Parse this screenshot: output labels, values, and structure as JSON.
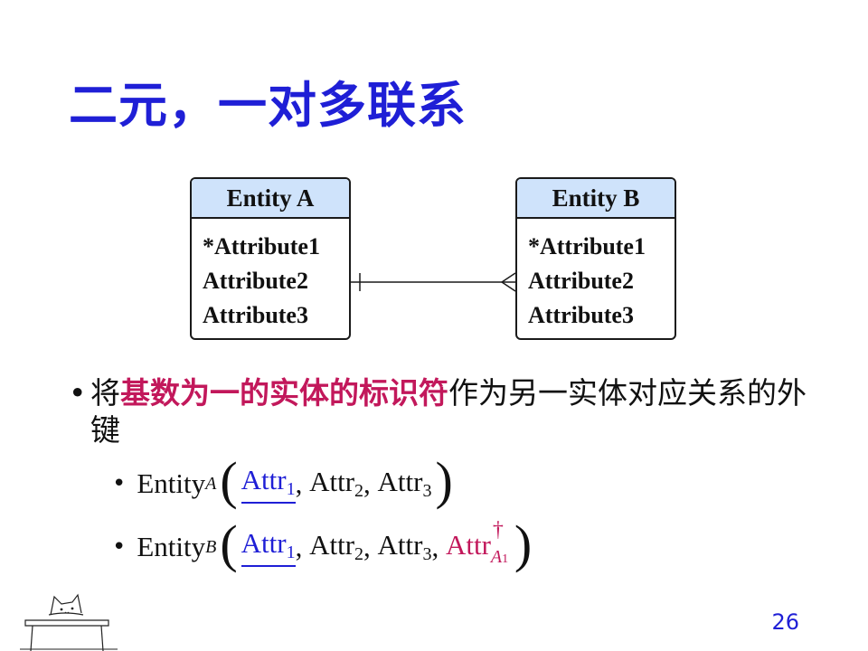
{
  "slide": {
    "title": "二元，一对多联系",
    "page_number": "26"
  },
  "diagram": {
    "entity_a": {
      "name": "Entity A",
      "attributes": [
        "*Attribute1",
        "Attribute2",
        "Attribute3"
      ]
    },
    "entity_b": {
      "name": "Entity B",
      "attributes": [
        "*Attribute1",
        "Attribute2",
        "Attribute3"
      ]
    },
    "relationship": {
      "side_a": "one",
      "side_b": "many"
    },
    "header_color": "#cfe3fb"
  },
  "bullets": {
    "main": {
      "prefix": "将",
      "highlight": "基数为一的实体的标识符",
      "suffix": "作为另一实体对应关系的外键"
    },
    "schema_a": {
      "entity": "Entity",
      "entity_sub": "A",
      "pk": "Attr",
      "pk_sub": "1",
      "sep1": ",",
      "attr2": "Attr",
      "attr2_sub": "2",
      "sep2": ",",
      "attr3": "Attr",
      "attr3_sub": "3"
    },
    "schema_b": {
      "entity": "Entity",
      "entity_sub": "B",
      "pk": "Attr",
      "pk_sub": "1",
      "sep1": ",",
      "attr2": "Attr",
      "attr2_sub": "2",
      "sep2": ",",
      "attr3": "Attr",
      "attr3_sub": "3",
      "sep3": ",",
      "fk": "Attr",
      "fk_sup": "†",
      "fk_sub": "A",
      "fk_sub_sub": "1"
    }
  },
  "colors": {
    "title": "#1f1fd6",
    "highlight": "#c2185b",
    "primary_key": "#1f1fd6",
    "foreign_key": "#c2185b"
  }
}
